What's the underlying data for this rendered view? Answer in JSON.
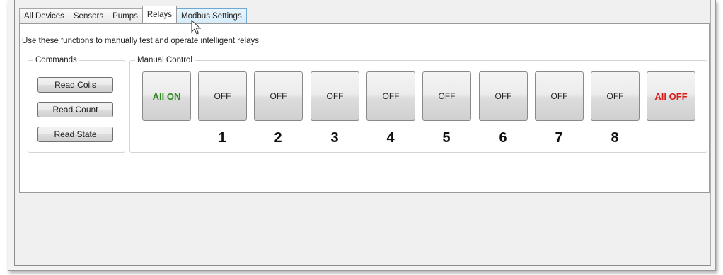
{
  "tabs": [
    {
      "label": "All Devices"
    },
    {
      "label": "Sensors"
    },
    {
      "label": "Pumps"
    },
    {
      "label": "Relays",
      "active": true
    },
    {
      "label": "Modbus Settings"
    }
  ],
  "description": "Use these functions to manually test and operate intelligent relays",
  "commands": {
    "legend": "Commands",
    "buttons": [
      "Read Coils",
      "Read Count",
      "Read State"
    ]
  },
  "manual_control": {
    "legend": "Manual Control",
    "all_on_label": "All ON",
    "all_off_label": "All OFF",
    "relays": [
      {
        "number": "1",
        "state": "OFF"
      },
      {
        "number": "2",
        "state": "OFF"
      },
      {
        "number": "3",
        "state": "OFF"
      },
      {
        "number": "4",
        "state": "OFF"
      },
      {
        "number": "5",
        "state": "OFF"
      },
      {
        "number": "6",
        "state": "OFF"
      },
      {
        "number": "7",
        "state": "OFF"
      },
      {
        "number": "8",
        "state": "OFF"
      }
    ]
  },
  "colors": {
    "all_on": "#2e8b1e",
    "all_off": "#dd1a1a",
    "tab_hover": "#d6ecfb"
  },
  "icons": {
    "cursor": "arrow-cursor-icon"
  }
}
